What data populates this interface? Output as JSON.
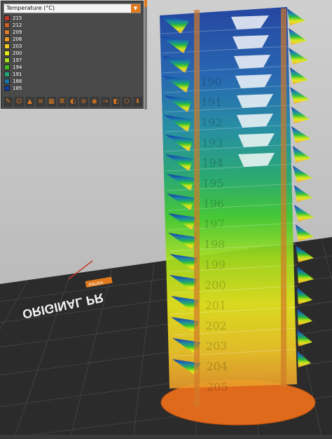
{
  "legend": {
    "title": "Temperature (°C)",
    "dropdown_icon": "caret-down",
    "items": [
      {
        "label": "215",
        "color": "#c0392b"
      },
      {
        "label": "212",
        "color": "#d35f2a"
      },
      {
        "label": "209",
        "color": "#e07a2a"
      },
      {
        "label": "206",
        "color": "#e89a2a"
      },
      {
        "label": "203",
        "color": "#f0c828"
      },
      {
        "label": "200",
        "color": "#e8e81e"
      },
      {
        "label": "197",
        "color": "#a8e01e"
      },
      {
        "label": "194",
        "color": "#40c020"
      },
      {
        "label": "191",
        "color": "#1fa87a"
      },
      {
        "label": "188",
        "color": "#1a76a8"
      },
      {
        "label": "185",
        "color": "#163a9c"
      }
    ]
  },
  "toolbar": {
    "icons": [
      "brush-icon",
      "profile-icon",
      "layers-icon",
      "shell-icon",
      "infill-icon",
      "support-icon",
      "color-icon",
      "wipe-icon",
      "seam-icon",
      "travel-icon",
      "solid-icon",
      "cube-icon",
      "export-icon"
    ]
  },
  "bed": {
    "logo_text": "ORIGINAL PR",
    "brand_badge": "PRUSA"
  },
  "tower_labels": [
    "190",
    "191",
    "192",
    "193",
    "194",
    "195",
    "196",
    "197",
    "198",
    "199",
    "200",
    "201",
    "202",
    "203",
    "204",
    "205"
  ]
}
